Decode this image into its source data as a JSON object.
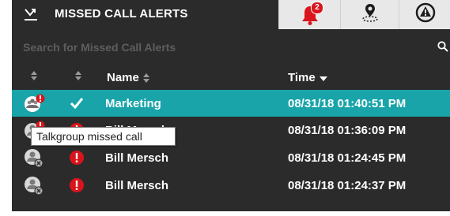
{
  "colors": {
    "panel_bg": "#2b2b2b",
    "selected_row": "#19a4a9",
    "alert_red": "#d9141c",
    "tab_bg": "#e8e8e8"
  },
  "tabs": {
    "active": {
      "label": "MISSED CALL ALERTS",
      "icon": "missed-call-icon"
    },
    "alarms": {
      "icon": "bell-alert-icon",
      "badge": "2"
    },
    "location": {
      "icon": "location-pin-icon"
    },
    "emergency": {
      "icon": "emergency-warning-icon"
    }
  },
  "search": {
    "placeholder": "Search for Missed Call Alerts",
    "value": ""
  },
  "columns": {
    "name": "Name",
    "time": "Time"
  },
  "rows": [
    {
      "type_icon": "talkgroup-alert-icon",
      "status_icon": "checkmark-icon",
      "name": "Marketing",
      "time": "08/31/18 01:40:51 PM",
      "selected": true
    },
    {
      "type_icon": "private-call-alert-icon",
      "status_icon": "red-alert-icon",
      "name": "Bill Mersch",
      "time": "08/31/18 01:36:09 PM",
      "selected": false
    },
    {
      "type_icon": "private-call-icon",
      "status_icon": "red-alert-icon",
      "name": "Bill Mersch",
      "time": "08/31/18 01:24:45 PM",
      "selected": false
    },
    {
      "type_icon": "private-call-icon",
      "status_icon": "red-alert-icon",
      "name": "Bill Mersch",
      "time": "08/31/18 01:24:37 PM",
      "selected": false
    }
  ],
  "tooltip": {
    "text": "Talkgroup missed call"
  }
}
